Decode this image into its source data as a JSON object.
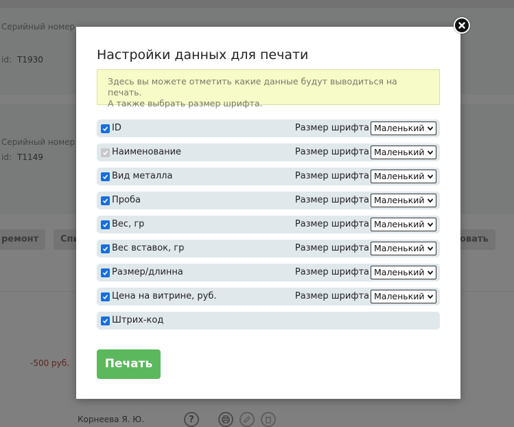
{
  "background": {
    "card1": {
      "serial_label": "Серийный номер",
      "id_label": "id:",
      "id_value": "T1930"
    },
    "card2": {
      "serial_label": "Серийный номер",
      "id_label": "id:",
      "id_value": "T1149"
    },
    "buttons": [
      "ремонт",
      "Спи",
      "овать"
    ],
    "price": "-500 руб.",
    "person": "Корнеева Я. Ю.",
    "help_glyph": "?"
  },
  "modal": {
    "title": "Настройки данных для печати",
    "notice_line1": "Здесь вы можете отметить какие данные будут выводиться на печать.",
    "notice_line2": "А также выбрать размер шрифта.",
    "font_size_label": "Размер шрифта",
    "rows": [
      {
        "label": "ID",
        "checked": true,
        "disabled": false,
        "font_size": "Маленький"
      },
      {
        "label": "Наименование",
        "checked": true,
        "disabled": true,
        "font_size": "Маленький"
      },
      {
        "label": "Вид металла",
        "checked": true,
        "disabled": false,
        "font_size": "Маленький"
      },
      {
        "label": "Проба",
        "checked": true,
        "disabled": false,
        "font_size": "Маленький"
      },
      {
        "label": "Вес, гр",
        "checked": true,
        "disabled": false,
        "font_size": "Маленький"
      },
      {
        "label": "Вес вставок, гр",
        "checked": true,
        "disabled": false,
        "font_size": "Маленький"
      },
      {
        "label": "Размер/длинна",
        "checked": true,
        "disabled": false,
        "font_size": "Маленький"
      },
      {
        "label": "Цена на витрине, руб.",
        "checked": true,
        "disabled": false,
        "font_size": "Маленький"
      },
      {
        "label": "Штрих-код",
        "checked": true,
        "disabled": false,
        "font_size": null
      }
    ],
    "print_button": "Печать",
    "icons": {
      "close": "close-icon",
      "checkbox": "checkmark-icon",
      "select": "chevron-down-icon"
    }
  },
  "colors": {
    "overlay": "rgba(0,0,0,0.5)",
    "notice_bg": "#f7fbc7",
    "row_bg": "#e1e8ec",
    "checkbox": "#1a6fd8",
    "print_button": "#5cb85c"
  }
}
